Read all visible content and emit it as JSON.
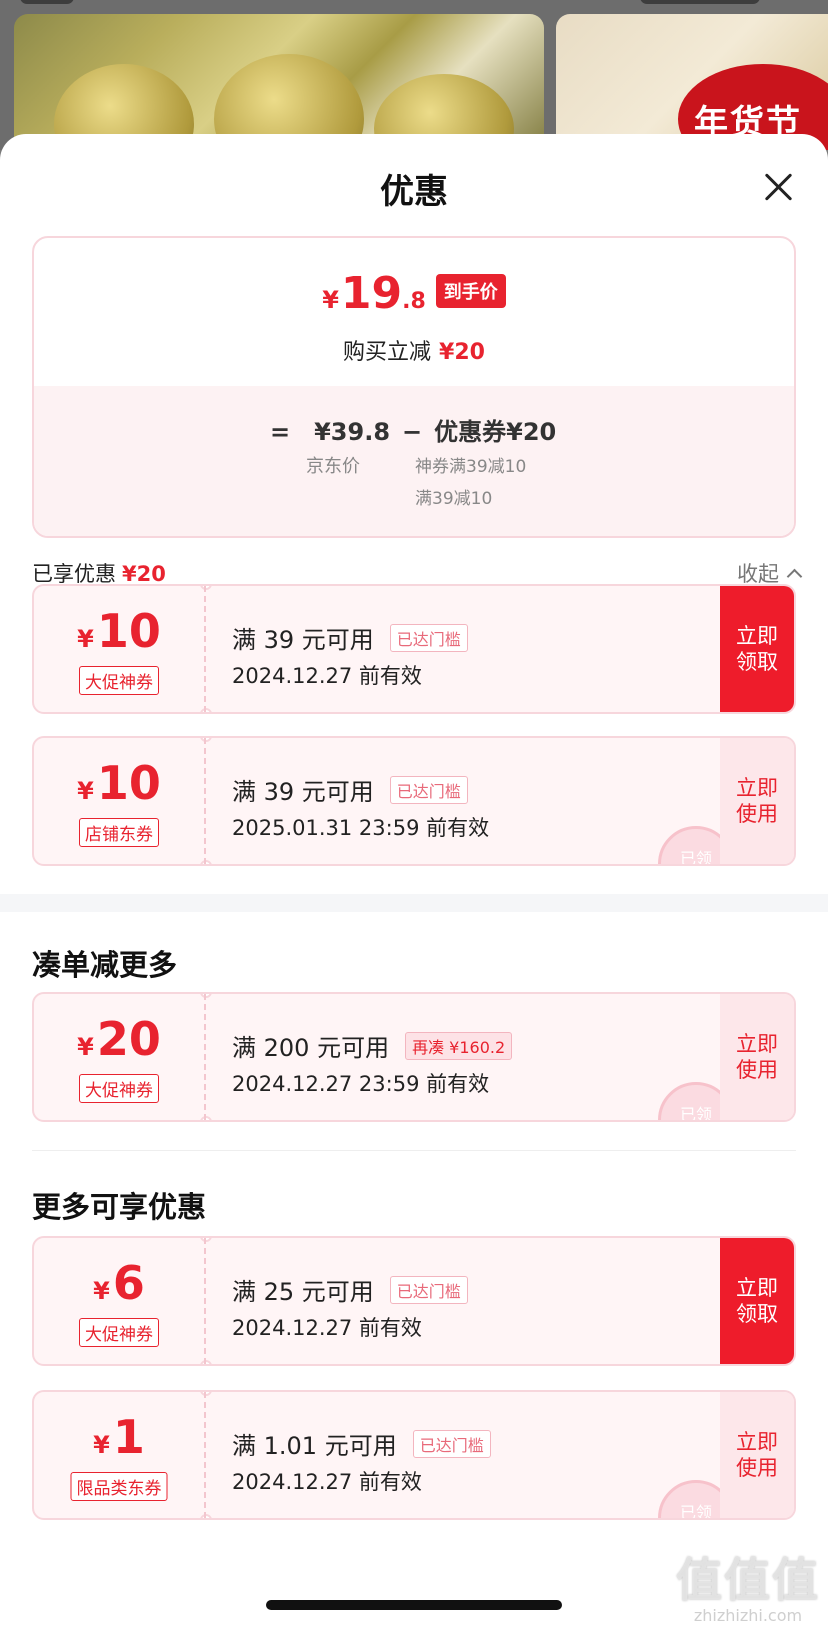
{
  "sheet": {
    "title": "优惠"
  },
  "summary": {
    "currency": "¥",
    "price_int": "19",
    "price_dec": ".8",
    "price_tag": "到手价",
    "instant_label": "购买立减",
    "instant_amount": "¥20",
    "calc_eq": "=",
    "calc_price": "¥39.8",
    "calc_minus": "−",
    "calc_coupon": "优惠券¥20",
    "calc_price_label": "京东价",
    "calc_detail_1": "神券满39减10",
    "calc_detail_2": "满39减10"
  },
  "enjoyed": {
    "label": "已享优惠",
    "amount": "¥20",
    "collapse_label": "收起"
  },
  "coupons_enjoyed": [
    {
      "currency": "¥",
      "amount": "10",
      "type": "大促神券",
      "condition": "满 39 元可用",
      "badge": "已达门槛",
      "valid": "2024.12.27 前有效",
      "action": "立即\n领取"
    },
    {
      "currency": "¥",
      "amount": "10",
      "type": "店铺东券",
      "condition": "满 39 元可用",
      "badge": "已达门槛",
      "valid": "2025.01.31 23:59 前有效",
      "action": "立即\n使用",
      "stamp": "已领"
    }
  ],
  "section_more": {
    "title": "凑单减更多"
  },
  "coupons_more": [
    {
      "currency": "¥",
      "amount": "20",
      "type": "大促神券",
      "condition": "满 200 元可用",
      "badge": "再凑 ¥160.2",
      "valid": "2024.12.27 23:59 前有效",
      "action": "立即\n使用",
      "stamp": "已领"
    }
  ],
  "section_other": {
    "title": "更多可享优惠"
  },
  "coupons_other": [
    {
      "currency": "¥",
      "amount": "6",
      "type": "大促神券",
      "condition": "满 25 元可用",
      "badge": "已达门槛",
      "valid": "2024.12.27 前有效",
      "action": "立即\n领取"
    },
    {
      "currency": "¥",
      "amount": "1",
      "type": "限品类东券",
      "condition": "满 1.01 元可用",
      "badge": "已达门槛",
      "valid": "2024.12.27 前有效",
      "action": "立即\n使用",
      "stamp": "已领"
    }
  ],
  "background": {
    "badge_text": "年货节"
  },
  "watermark": {
    "main": "值值值",
    "sub": "zhizhizhi.com"
  },
  "colors": {
    "accent": "#e8232f",
    "action_red": "#ee1c2b",
    "coupon_bg": "#fff5f6",
    "border": "#f7d6dc"
  }
}
